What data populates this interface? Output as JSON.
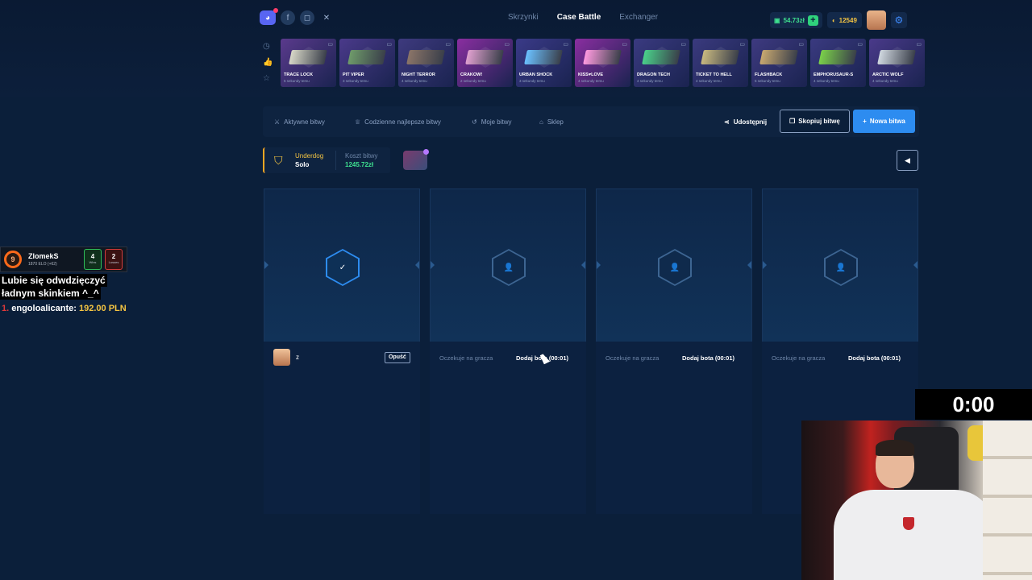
{
  "header": {
    "nav": [
      "Skrzynki",
      "Case Battle",
      "Exchanger"
    ],
    "active_nav": "Case Battle",
    "balance": "54.73zł",
    "coins": "12549"
  },
  "drops": [
    {
      "name": "TRACE LOCK",
      "sub": "5 sekundy temu",
      "bg": "#5a3a8c",
      "weapon": "#d8d8c8"
    },
    {
      "name": "PIT VIPER",
      "sub": "3 sekundy temu",
      "bg": "#4a3a8a",
      "weapon": "#6e9a6a"
    },
    {
      "name": "NIGHT TERROR",
      "sub": "4 sekundy temu",
      "bg": "#3e3a7e",
      "weapon": "#8a7468"
    },
    {
      "name": "CRAKOW!",
      "sub": "2 sekundy temu",
      "bg": "#8a2ea0",
      "weapon": "#e0a0d0"
    },
    {
      "name": "URBAN SHOCK",
      "sub": "3 sekundy temu",
      "bg": "#3a3a88",
      "weapon": "#6ac0ff"
    },
    {
      "name": "KISS♥LOVE",
      "sub": "4 sekundy temu",
      "bg": "#8a2ea0",
      "weapon": "#ff9ae0"
    },
    {
      "name": "DRAGON TECH",
      "sub": "4 sekundy temu",
      "bg": "#3a3a80",
      "weapon": "#4ad08a"
    },
    {
      "name": "TICKET TO HELL",
      "sub": "4 sekundy temu",
      "bg": "#3a3a7e",
      "weapon": "#c8b880"
    },
    {
      "name": "FLASHBACK",
      "sub": "5 sekundy temu",
      "bg": "#3e3a80",
      "weapon": "#c8a870"
    },
    {
      "name": "EMPHORUSAUR-S",
      "sub": "4 sekundy temu",
      "bg": "#3a3a80",
      "weapon": "#7ad04a"
    },
    {
      "name": "ARCTIC WOLF",
      "sub": "4 sekundy temu",
      "bg": "#4a3a8a",
      "weapon": "#d0d8e0"
    }
  ],
  "tabs": [
    "Aktywne bitwy",
    "Codzienne najlepsze bitwy",
    "Moje bitwy",
    "Sklep"
  ],
  "actions": {
    "share": "Udostępnij",
    "copy": "Skopiuj bitwę",
    "new": "Nowa bitwa"
  },
  "battle": {
    "mode_name": "Underdog",
    "mode_type": "Solo",
    "cost_label": "Koszt bitwy",
    "cost_value": "1245.72zł"
  },
  "slots": [
    {
      "player": "z",
      "leave": "Opuść"
    },
    {
      "wait": "Oczekuje na gracza",
      "add_bot": "Dodaj bota (00:01)"
    },
    {
      "wait": "Oczekuje na gracza",
      "add_bot": "Dodaj bota (00:01)"
    },
    {
      "wait": "Oczekuje na gracza",
      "add_bot": "Dodaj bota (00:01)"
    }
  ],
  "stream_overlay": {
    "level": "9",
    "name": "ZlomekS",
    "elo": "1870 ELO (+62)",
    "wins": "4",
    "wins_label": "Wins",
    "losses": "2",
    "losses_label": "Losses",
    "message_line1": "Lubie się odwdzięczyć",
    "message_line2": "ładnym skinkiem ^_^",
    "donor_rank": "1.",
    "donor_name": "engoloalicante:",
    "donor_amount": "192.00 PLN",
    "timer": "0:00"
  }
}
